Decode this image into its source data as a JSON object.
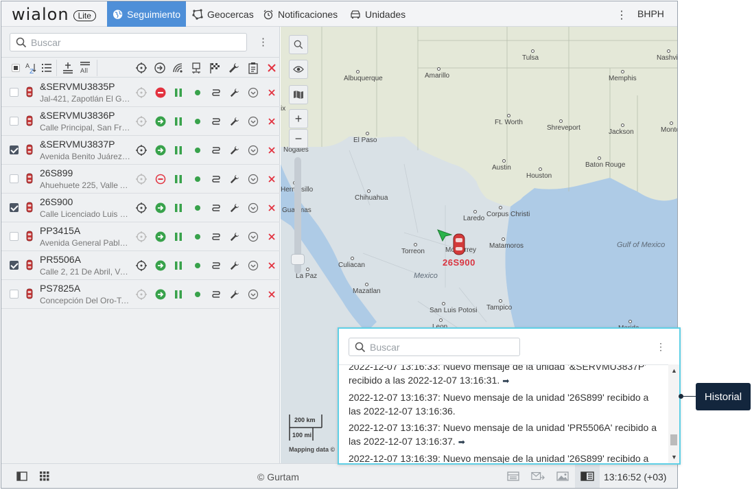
{
  "app": {
    "logo_text": "wialon",
    "logo_badge": "Lite",
    "user": "BHPH",
    "menu_glyph": "⋮"
  },
  "nav": {
    "tabs": [
      {
        "label": "Seguimiento",
        "icon": "globe-icon",
        "active": true
      },
      {
        "label": "Geocercas",
        "icon": "geofence-icon",
        "active": false
      },
      {
        "label": "Notificaciones",
        "icon": "alarm-clock-icon",
        "active": false
      },
      {
        "label": "Unidades",
        "icon": "car-icon",
        "active": false
      }
    ]
  },
  "sidebar": {
    "search_placeholder": "Buscar",
    "menu_glyph": "⋮",
    "toolbar_all_label": "All",
    "units": [
      {
        "name": "&SERVMU3835P",
        "address": "Jal-421, Zapotlán El Gr...",
        "checked": false,
        "status": "stop"
      },
      {
        "name": "&SERVMU3836P",
        "address": "Calle Principal, San Fra...",
        "checked": false,
        "status": "go"
      },
      {
        "name": "&SERVMU3837P",
        "address": "Avenida Benito Juárez ...",
        "checked": true,
        "status": "go"
      },
      {
        "name": "26S899",
        "address": "Ahuehuete 225, Valle A...",
        "checked": false,
        "status": "stop-outline"
      },
      {
        "name": "26S900",
        "address": "Calle Licenciado Luis E...",
        "checked": true,
        "status": "go"
      },
      {
        "name": "PP3415A",
        "address": "Avenida General Pablo ...",
        "checked": false,
        "status": "go"
      },
      {
        "name": "PR5506A",
        "address": "Calle 2, 21 De Abril, Ver...",
        "checked": true,
        "status": "go"
      },
      {
        "name": "PS7825A",
        "address": "Concepción Del Oro-Te...",
        "checked": false,
        "status": "go"
      }
    ]
  },
  "map": {
    "cities": [
      "Tulsa",
      "Nashvi",
      "Albuquerque",
      "Amarillo",
      "Memphis",
      "Ft. Worth",
      "Shreveport",
      "Jackson",
      "Monto",
      "El Paso",
      "Nogales",
      "Austin",
      "Baton Rouge",
      "Houston",
      "Hermosillo",
      "Chihuahua",
      "Guaymas",
      "Laredo",
      "Corpus Christi",
      "Torreon",
      "Monterrey",
      "Matamoros",
      "Culiacan",
      "La Paz",
      "Mazatlan",
      "San Luis Potosi",
      "Tampico",
      "Leon",
      "Merida",
      "ix"
    ],
    "regions": [
      "Mexico",
      "Gulf of Mexico"
    ],
    "unit_label": "26S900",
    "scale_km": "200 km",
    "scale_mi": "100 mi",
    "attribution": "Mapping data ©"
  },
  "history": {
    "search_placeholder": "Buscar",
    "menu_glyph": "⋮",
    "messages": [
      {
        "text": "2022-12-07 13:16:33: Nuevo mensaje de la unidad '&SERVMU3837P' recibido a las 2022-12-07 13:16:31.",
        "arrow": true
      },
      {
        "text": "2022-12-07 13:16:37: Nuevo mensaje de la unidad '26S899' recibido a las 2022-12-07 13:16:36.",
        "arrow": false
      },
      {
        "text": "2022-12-07 13:16:37: Nuevo mensaje de la unidad 'PR5506A' recibido a las 2022-12-07 13:16:37.",
        "arrow": true
      },
      {
        "text": "2022-12-07 13:16:39: Nuevo mensaje de la unidad '26S899' recibido a",
        "arrow": false
      }
    ],
    "arrow_glyph": "➡"
  },
  "callout": {
    "label": "Historial"
  },
  "footer": {
    "copyright": "© Gurtam",
    "clock": "13:16:52 (+03)"
  }
}
